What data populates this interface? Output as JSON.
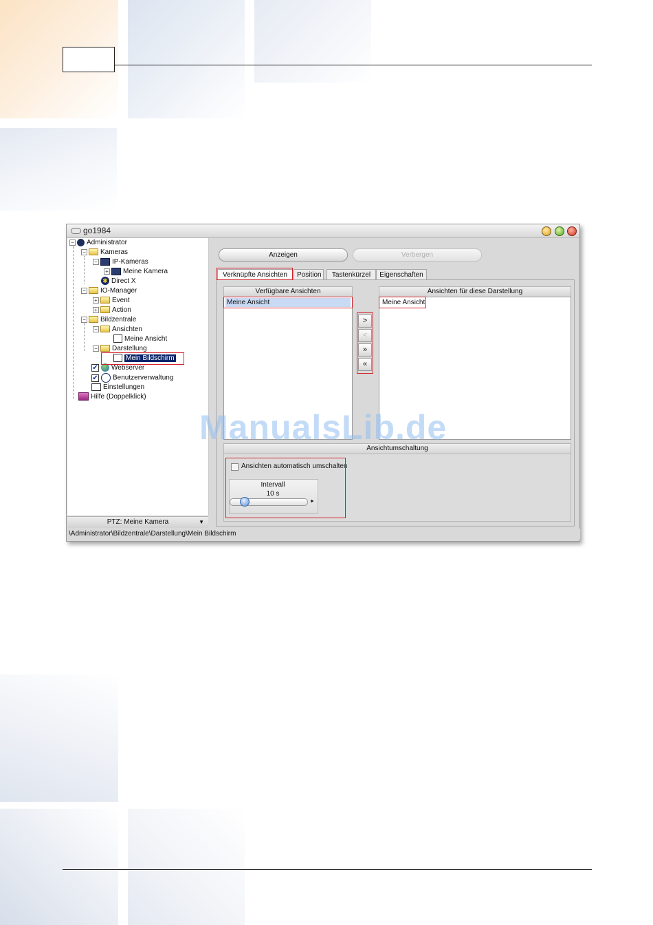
{
  "window": {
    "title": "go1984"
  },
  "tree": {
    "items": [
      {
        "label": "Administrator"
      },
      {
        "label": "Kameras"
      },
      {
        "label": "IP-Kameras"
      },
      {
        "label": "Meine Kamera"
      },
      {
        "label": "Direct X"
      },
      {
        "label": "IO-Manager"
      },
      {
        "label": "Event"
      },
      {
        "label": "Action"
      },
      {
        "label": "Bildzentrale"
      },
      {
        "label": "Ansichten"
      },
      {
        "label": "Meine Ansicht"
      },
      {
        "label": "Darstellung"
      },
      {
        "label": "Mein Bildschirm"
      },
      {
        "label": "Webserver"
      },
      {
        "label": "Benutzerverwaltung"
      },
      {
        "label": "Einstellungen"
      },
      {
        "label": "Hilfe (Doppelklick)"
      }
    ]
  },
  "ptz": {
    "label": "PTZ: Meine Kamera"
  },
  "status_path": "\\Administrator\\Bildzentrale\\Darstellung\\Mein Bildschirm",
  "actions": {
    "show_label": "Anzeigen",
    "hide_label": "Verbergen"
  },
  "tabs": [
    {
      "label": "Verknüpfte Ansichten",
      "active": true
    },
    {
      "label": "Position"
    },
    {
      "label": "Tastenkürzel"
    },
    {
      "label": "Eigenschaften"
    }
  ],
  "available_views": {
    "header": "Verfügbare Ansichten",
    "items": [
      "Meine Ansicht"
    ]
  },
  "assigned_views": {
    "header": "Ansichten für diese Darstellung",
    "items": [
      "Meine Ansicht"
    ]
  },
  "transfer_buttons": [
    {
      "glyph": ">",
      "enabled": true
    },
    {
      "glyph": "<",
      "enabled": false
    },
    {
      "glyph": "»",
      "enabled": true
    },
    {
      "glyph": "«",
      "enabled": true
    }
  ],
  "switching": {
    "header": "Ansichtumschaltung",
    "auto_switch_label": "Ansichten automatisch umschalten",
    "auto_switch_checked": false,
    "interval_label": "Intervall",
    "interval_value": "10 s"
  },
  "watermark": "ManualsLib.de",
  "colors": {
    "highlight_red": "#d4202a",
    "selection": "#0a246a"
  }
}
